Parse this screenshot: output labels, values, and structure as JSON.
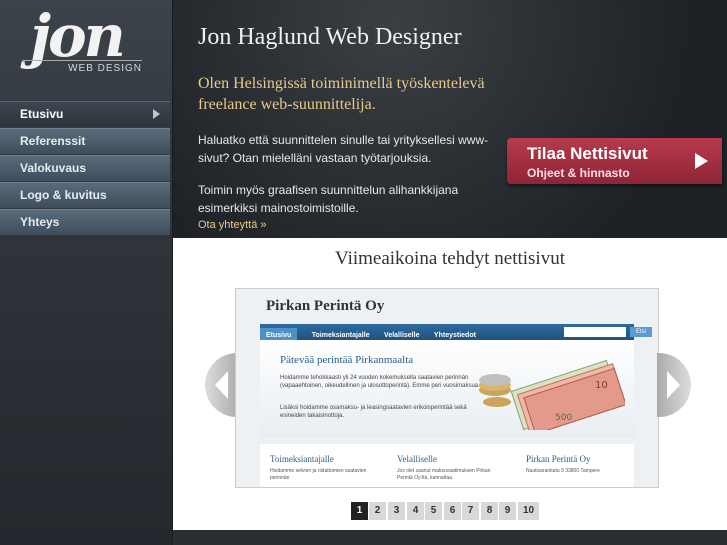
{
  "logo": {
    "text": "jon",
    "subtitle": "WEB DESIGN"
  },
  "nav": {
    "items": [
      {
        "label": "Etusivu",
        "active": true
      },
      {
        "label": "Referenssit"
      },
      {
        "label": "Valokuvaus"
      },
      {
        "label": "Logo & kuvitus"
      },
      {
        "label": "Yhteys"
      }
    ]
  },
  "header": {
    "title": "Jon Haglund Web Designer",
    "intro": "Olen Helsingissä toiminimellä työskentelevä freelance web-suunnittelija.",
    "paragraph1": "Haluatko että suunnittelen sinulle tai yrityksellesi www-sivut? Otan mielelläni vastaan työtarjouksia.",
    "paragraph2": "Toimin myös graafisen suunnittelun alihankkijana esimerkiksi mainostoimistoille.",
    "contact_link": "Ota yhteyttä »"
  },
  "cta": {
    "title": "Tilaa Nettisivut",
    "subtitle": "Ohjeet & hinnasto"
  },
  "showcase": {
    "title": "Viimeaikoina tehdyt nettisivut",
    "site": {
      "name": "Pirkan Perintä Oy",
      "nav": [
        "Etusivu",
        "Toimeksiantajalle",
        "Velalliselle",
        "Yhteystiedot"
      ],
      "search_button": "Etsi",
      "heading": "Pätevää perintää Pirkanmaalta",
      "text1": "Hoidamme tehokkaasti yli 24 vuoden kokemuksella saatavien perinnän (vapaaehtoinen, oikeudellinen ja ulosottoperintä). Emme peri vuosimaksua.",
      "text2": "Lisäksi hoidamme osamaksu- ja leasingsaatavien erikoisperintää sekä esineiden takaisinottoja.",
      "columns": [
        {
          "title": "Toimeksiantajalle",
          "text": "Hoidamme selvien ja riidattomien saatavien perinnän"
        },
        {
          "title": "Velalliselle",
          "text": "Jos olet saanut maksuvaatimuksen Pirkan Perintä Oy:ltä, kannattaa"
        },
        {
          "title": "Pirkan Perintä Oy",
          "text": "Nuutisarankatu 9 33800 Tampere"
        }
      ]
    }
  },
  "pagination": {
    "pages": [
      "1",
      "2",
      "3",
      "4",
      "5",
      "6",
      "7",
      "8",
      "9",
      "10"
    ],
    "current": "1"
  },
  "colors": {
    "accent": "#e9c98a",
    "cta": "#a83044",
    "nav": "#4c5e6d"
  }
}
